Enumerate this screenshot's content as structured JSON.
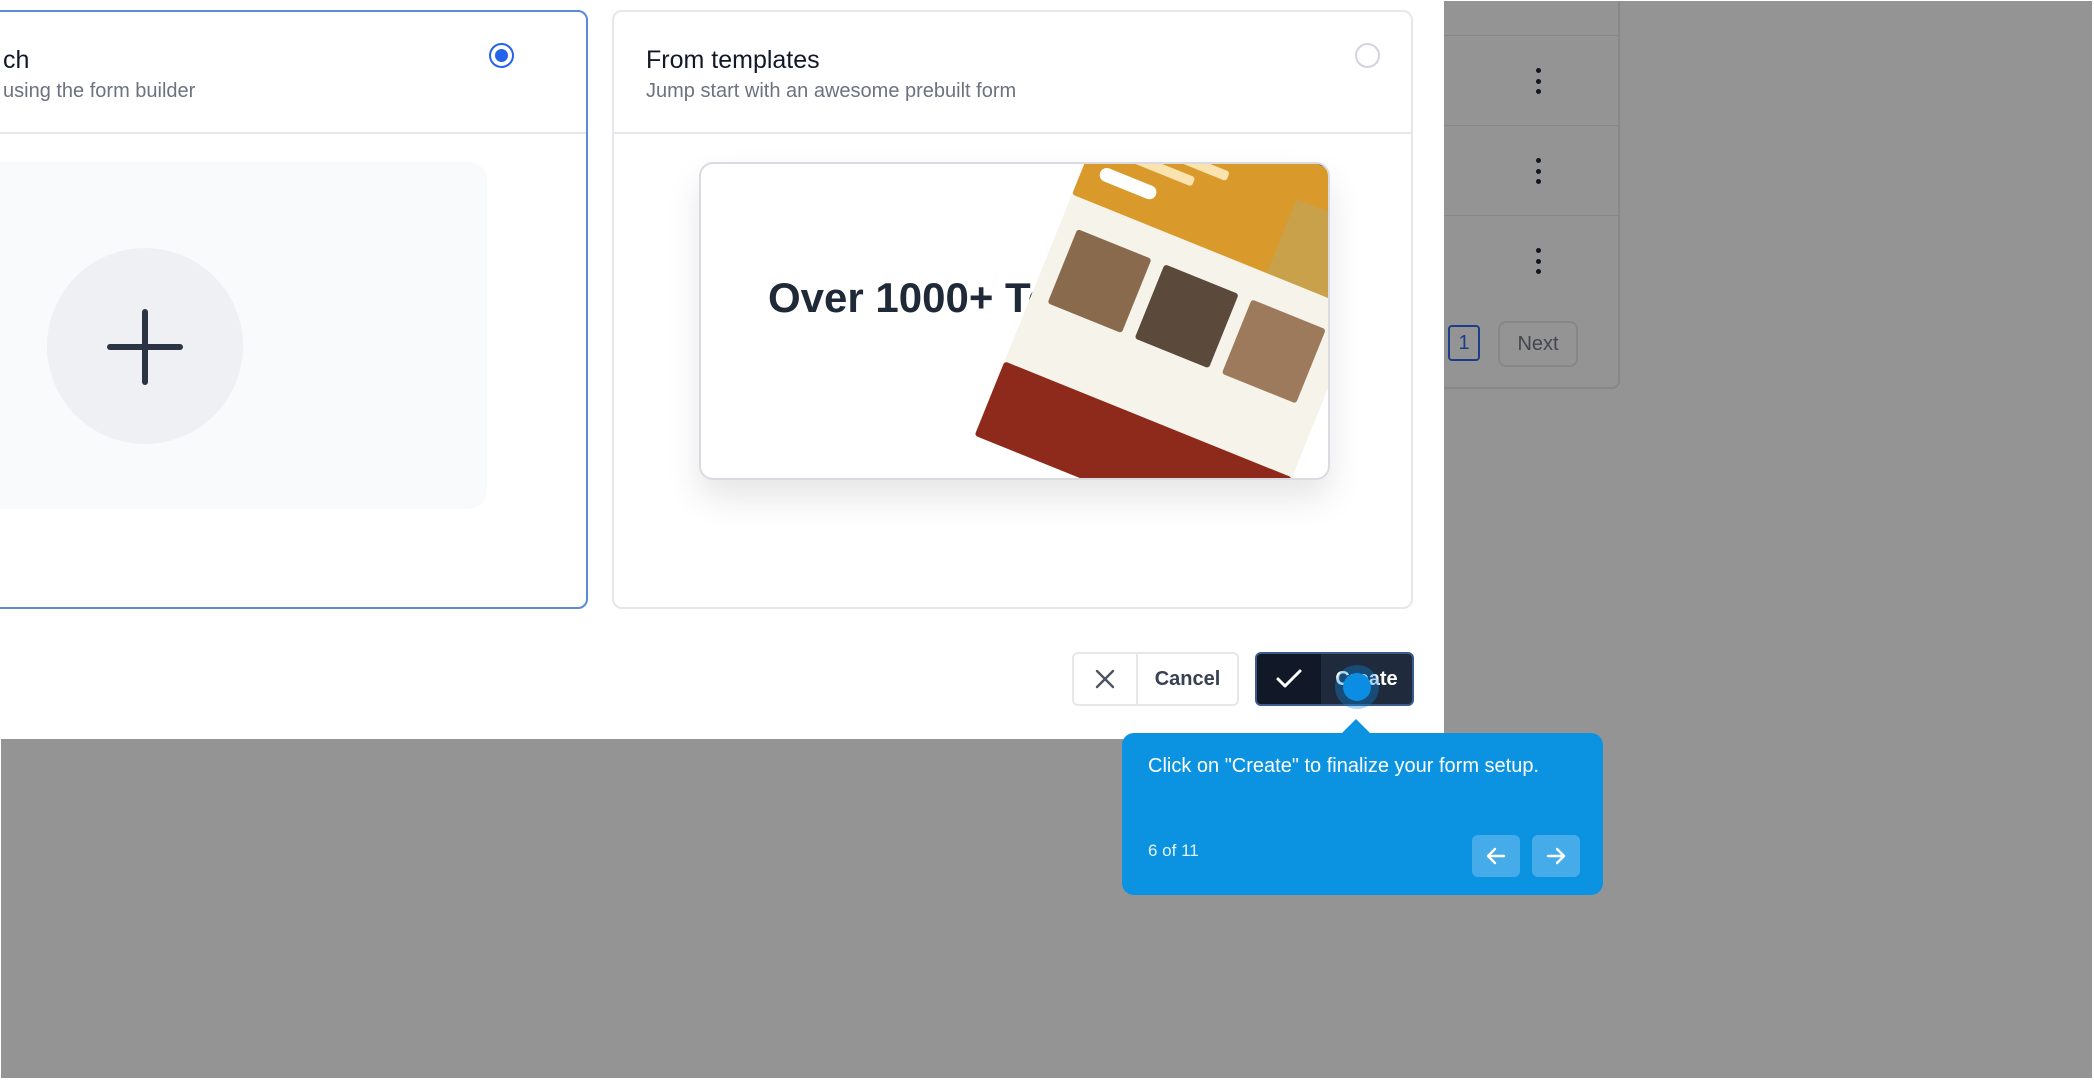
{
  "modal": {
    "card_scratch": {
      "title": "ch",
      "subtitle": "using the form builder",
      "selected": true
    },
    "card_templates": {
      "title": "From templates",
      "subtitle": "Jump start with an awesome prebuilt form",
      "selected": false,
      "preview_text": "Over 1000+ Templates"
    },
    "cancel_label": "Cancel",
    "create_label": "Create"
  },
  "background": {
    "pagination": {
      "current_page": "1",
      "next_label": "Next"
    }
  },
  "tooltip": {
    "text": "Click on \"Create\" to finalize your form setup.",
    "step": "6 of 11"
  },
  "colors": {
    "primary": "#2563eb",
    "tooltip_bg": "#0b93e2",
    "create_button": "#1f2a3d"
  },
  "icons": [
    "plus-icon",
    "kebab-menu-icon",
    "close-icon",
    "check-icon",
    "arrow-left-icon",
    "arrow-right-icon"
  ]
}
